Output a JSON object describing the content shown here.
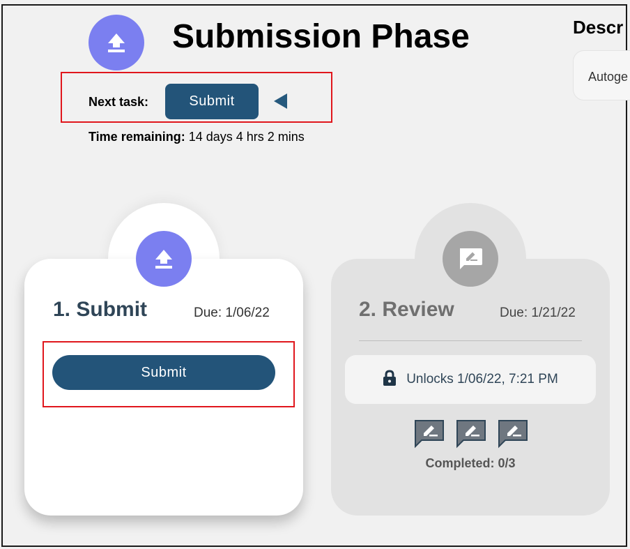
{
  "header": {
    "title": "Submission Phase",
    "icon": "upload-icon",
    "accent_color": "#7b7ff0"
  },
  "description": {
    "title": "Descr",
    "text": "Autoge"
  },
  "next_task": {
    "label": "Next task:",
    "button_label": "Submit"
  },
  "time_remaining": {
    "label": "Time remaining:",
    "value": " 14 days 4 hrs 2 mins"
  },
  "cards": {
    "submit": {
      "title": "1. Submit",
      "due": "Due: 1/06/22",
      "button_label": "Submit",
      "icon": "upload-icon"
    },
    "review": {
      "title": "2. Review",
      "due": "Due: 1/21/22",
      "unlock_text": "Unlocks 1/06/22, 7:21 PM",
      "completed": "Completed: 0/3",
      "icon": "review-comment-icon",
      "review_items": [
        "review-item-1",
        "review-item-2",
        "review-item-3"
      ]
    }
  },
  "colors": {
    "primary_button": "#235479",
    "highlight": "#e0161c",
    "locked_card": "#e2e2e2"
  }
}
